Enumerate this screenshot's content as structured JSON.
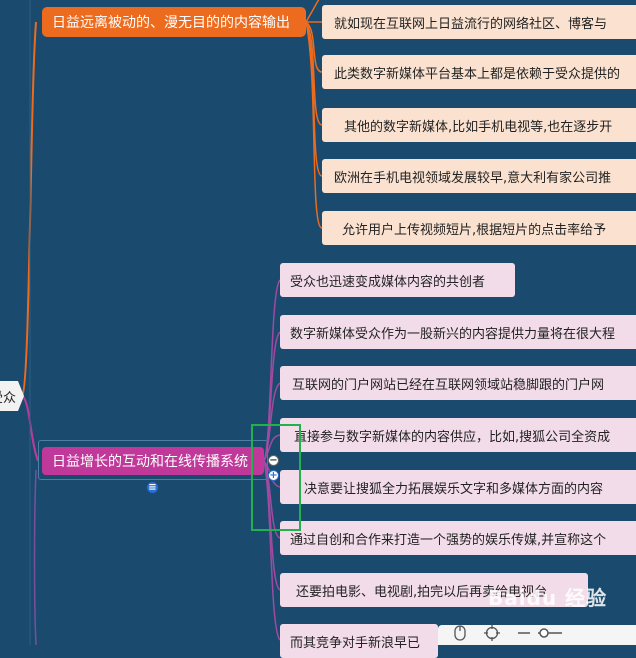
{
  "root": {
    "label": "受众"
  },
  "branches": [
    {
      "label": "日益远离被动的、漫无目的的内容输出",
      "color": "#ec6b1f",
      "children": [
        "就如现在互联网上日益流行的网络社区、博客与",
        "此类数字新媒体平台基本上都是依赖于受众提供的",
        "其他的数字新媒体,比如手机电视等,也在逐步开",
        "欧洲在手机电视领域发展较早,意大利有家公司推",
        "允许用户上传视频短片,根据短片的点击率给予"
      ]
    },
    {
      "label": "日益增长的互动和在线传播系统",
      "color": "#c0399a",
      "children": [
        "受众也迅速变成媒体内容的共创者",
        "数字新媒体受众作为一股新兴的内容提供力量将在很大程",
        "互联网的门户网站已经在互联网领域站稳脚跟的门户网",
        "直接参与数字新媒体的内容供应，比如,搜狐公司全资成",
        "决意要让搜狐全力拓展娱乐文字和多媒体方面的内容",
        "通过自创和合作来打造一个强势的娱乐传媒,并宣称这个",
        "还要拍电影、电视剧,拍完以后再卖给电视台",
        "而其竞争对手新浪早已"
      ]
    }
  ],
  "controls": {
    "collapse_symbol": "−",
    "expand_symbol": "+",
    "detail_symbol": "≡"
  },
  "toolbar": {
    "icons": [
      "mouse-icon",
      "locate-icon",
      "zoom-slider-icon"
    ]
  },
  "watermark": "Baidu 经验",
  "colors": {
    "background": "#1a4a6e",
    "peach_node": "#fbe2d0",
    "pink_node": "#f3dcea",
    "highlight_box": "#22b14c"
  }
}
